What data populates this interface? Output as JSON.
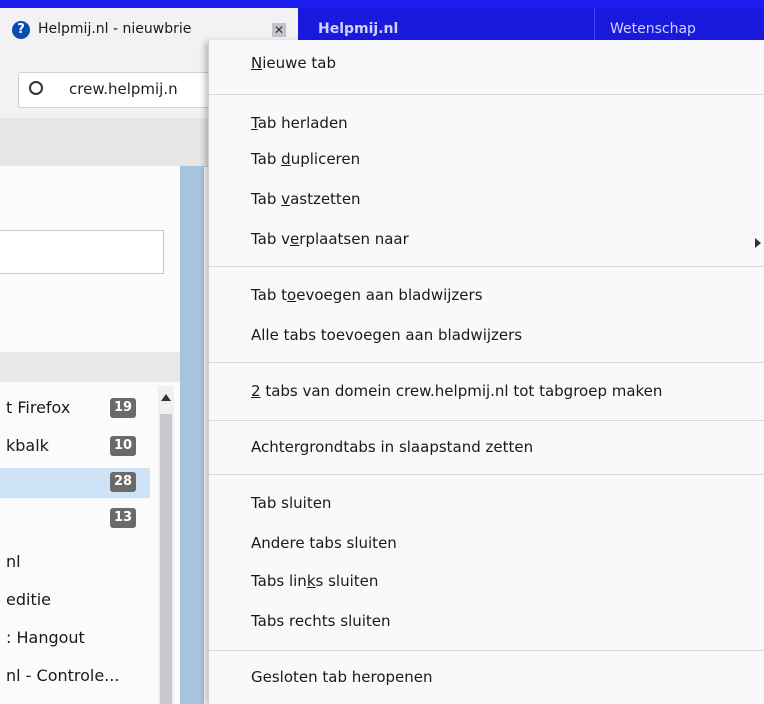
{
  "tabs": {
    "active_title": "Helpmij.nl - nieuwbrie",
    "inactive_titles": [
      "Helpmij.nl",
      "Wetenschap"
    ]
  },
  "address_bar": {
    "url": "crew.helpmij.n"
  },
  "sidebar": {
    "rows": [
      {
        "text": "t Firefox",
        "badge": "19"
      },
      {
        "text": "kbalk",
        "badge": "10"
      },
      {
        "text": "",
        "badge": "28"
      },
      {
        "text": "",
        "badge": "13"
      },
      {
        "text": "nl",
        "badge": ""
      },
      {
        "text": "editie",
        "badge": ""
      },
      {
        "text": ": Hangout",
        "badge": ""
      },
      {
        "text": "nl - Controle...",
        "badge": ""
      }
    ]
  },
  "context_menu": {
    "new_tab": {
      "pre": "",
      "key": "N",
      "post": "ieuwe tab"
    },
    "reload": {
      "pre": "",
      "key": "T",
      "post": "ab herladen"
    },
    "duplicate": {
      "pre": "Tab ",
      "key": "d",
      "post": "upliceren"
    },
    "pin": {
      "pre": "Tab ",
      "key": "v",
      "post": "astzetten"
    },
    "move": {
      "pre": "Tab v",
      "key": "e",
      "post": "rplaatsen naar"
    },
    "bookmark": {
      "pre": "Tab t",
      "key": "o",
      "post": "evoegen aan bladwijzers"
    },
    "bookmark_all": "Alle tabs toevoegen aan bladwijzers",
    "group": {
      "pre": "",
      "key": "2",
      "post": " tabs van domein crew.helpmij.nl tot tabgroep maken"
    },
    "sleep": "Achtergrondtabs in slaapstand zetten",
    "close": "Tab sluiten",
    "close_others": "Andere tabs sluiten",
    "close_left": {
      "pre": "Tabs lin",
      "key": "k",
      "post": "s sluiten"
    },
    "close_right": "Tabs rechts sluiten",
    "reopen": "Gesloten tab heropenen"
  }
}
